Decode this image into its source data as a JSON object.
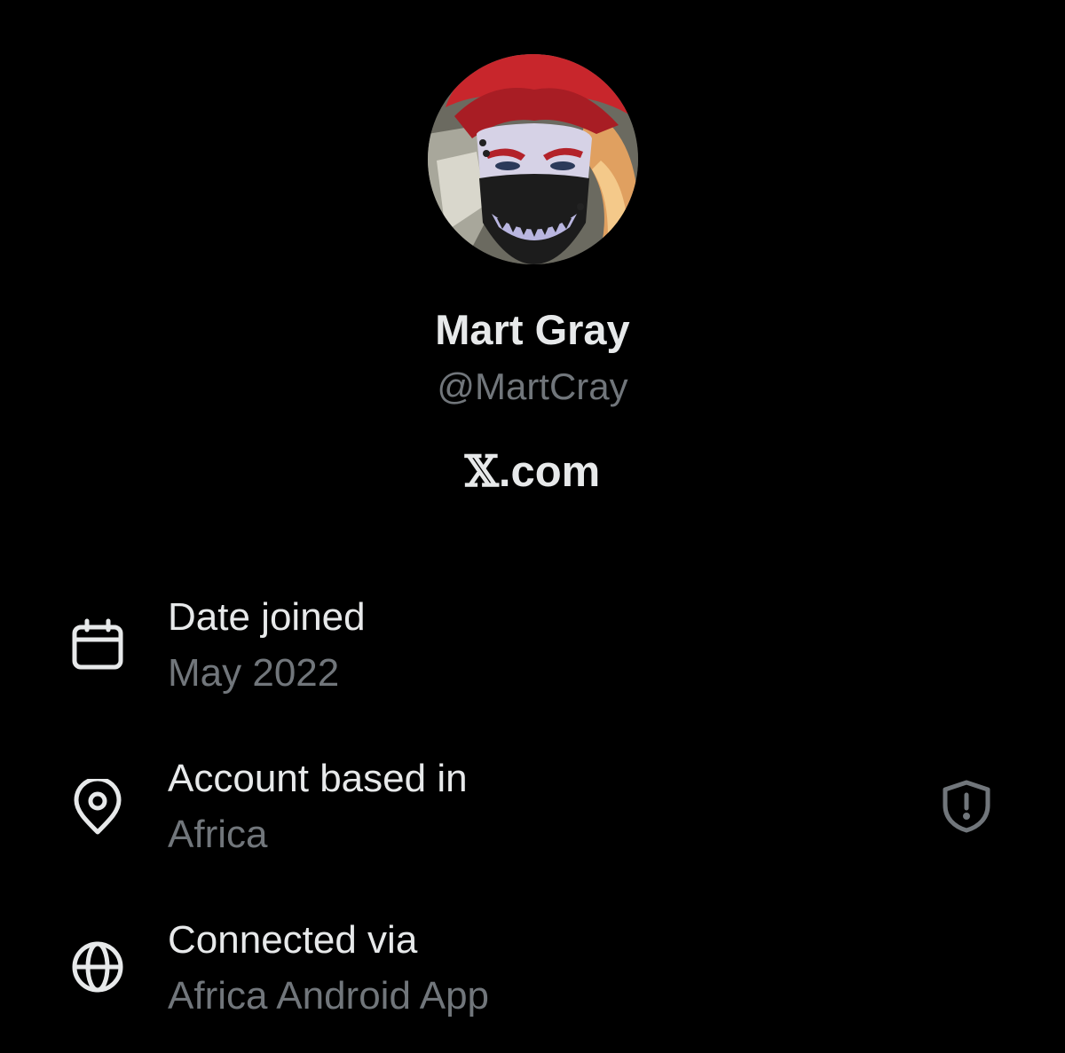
{
  "profile": {
    "display_name": "Mart Gray",
    "handle": "@MartCray",
    "avatar_icon": "avatar-image"
  },
  "brand": {
    "x_letter": "𝕏",
    "suffix": ".com"
  },
  "info": [
    {
      "icon": "calendar-icon",
      "label": "Date joined",
      "value": "May 2022"
    },
    {
      "icon": "location-pin-icon",
      "label": "Account based in",
      "value": "Africa"
    },
    {
      "icon": "globe-icon",
      "label": "Connected via",
      "value": "Africa Android App"
    }
  ],
  "colors": {
    "background": "#000000",
    "primary_text": "#e7e9ea",
    "secondary_text": "#71767b"
  }
}
